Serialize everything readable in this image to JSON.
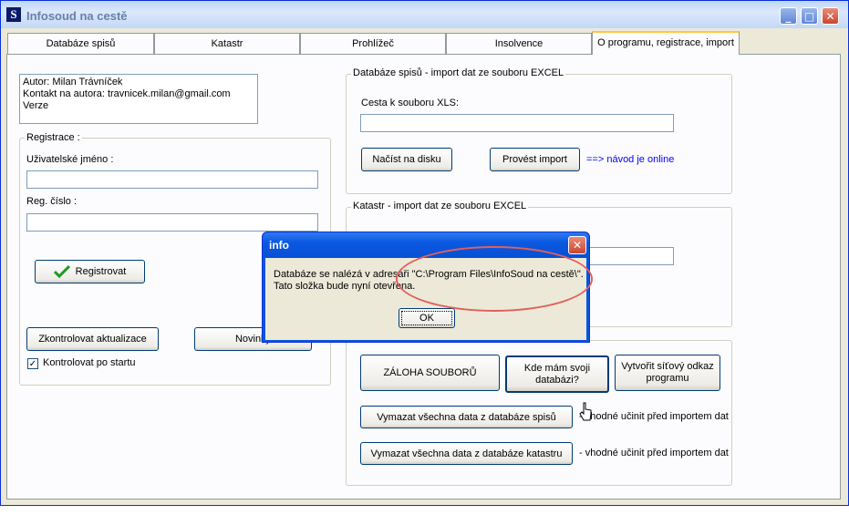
{
  "window": {
    "title": "Infosoud na cestě"
  },
  "tabs": [
    {
      "label": "Databáze spisů"
    },
    {
      "label": "Katastr"
    },
    {
      "label": "Prohlížeč"
    },
    {
      "label": "Insolvence"
    },
    {
      "label": "O programu, registrace, import",
      "active": true
    }
  ],
  "about": {
    "lines": [
      "Autor: Milan Trávníček",
      "Kontakt na autora: travnicek.milan@gmail.com",
      "Verze"
    ]
  },
  "registration": {
    "title": "Registrace :",
    "username_label": "Uživatelské jméno :",
    "username_value": "",
    "regnum_label": "Reg. číslo :",
    "regnum_value": "",
    "register_button": "Registrovat",
    "check_updates_button": "Zkontrolovat aktualizace",
    "news_button": "Novinky",
    "check_on_start_label": "Kontrolovat po startu",
    "check_on_start_checked": true
  },
  "import_spisy": {
    "title": "Databáze spisů - import dat ze souboru EXCEL",
    "path_label": "Cesta k souboru XLS:",
    "path_value": "",
    "load_button": "Načíst na disku",
    "import_button": "Provést import",
    "online_link": "==> návod je online"
  },
  "import_katastr": {
    "title": "Katastr - import dat ze souboru EXCEL",
    "path_value": ""
  },
  "backup": {
    "backup_button": "ZÁLOHA SOUBORŮ",
    "where_db_button": "Kde mám svoji databázi?",
    "network_link_button": "Vytvořit síťový odkaz programu",
    "clear_spisy_button": "Vymazat všechna data z databáze spisů",
    "clear_spisy_note": "- vhodné učinit před importem dat",
    "clear_katastr_button": "Vymazat všechna data z databáze katastru",
    "clear_katastr_note": "- vhodné učinit před importem dat"
  },
  "dialog": {
    "title": "info",
    "message_line1": "Databáze se nalézá v adresáři \"C:\\Program Files\\InfoSoud na cestě\\\".",
    "message_line2": "Tato složka bude nyní otevřena.",
    "ok_button": "OK"
  },
  "colors": {
    "accent_tab": "#ffc83c",
    "dialog_titlebar": "#0a58e2",
    "highlight": "#e0605a",
    "link": "#0000ff"
  }
}
